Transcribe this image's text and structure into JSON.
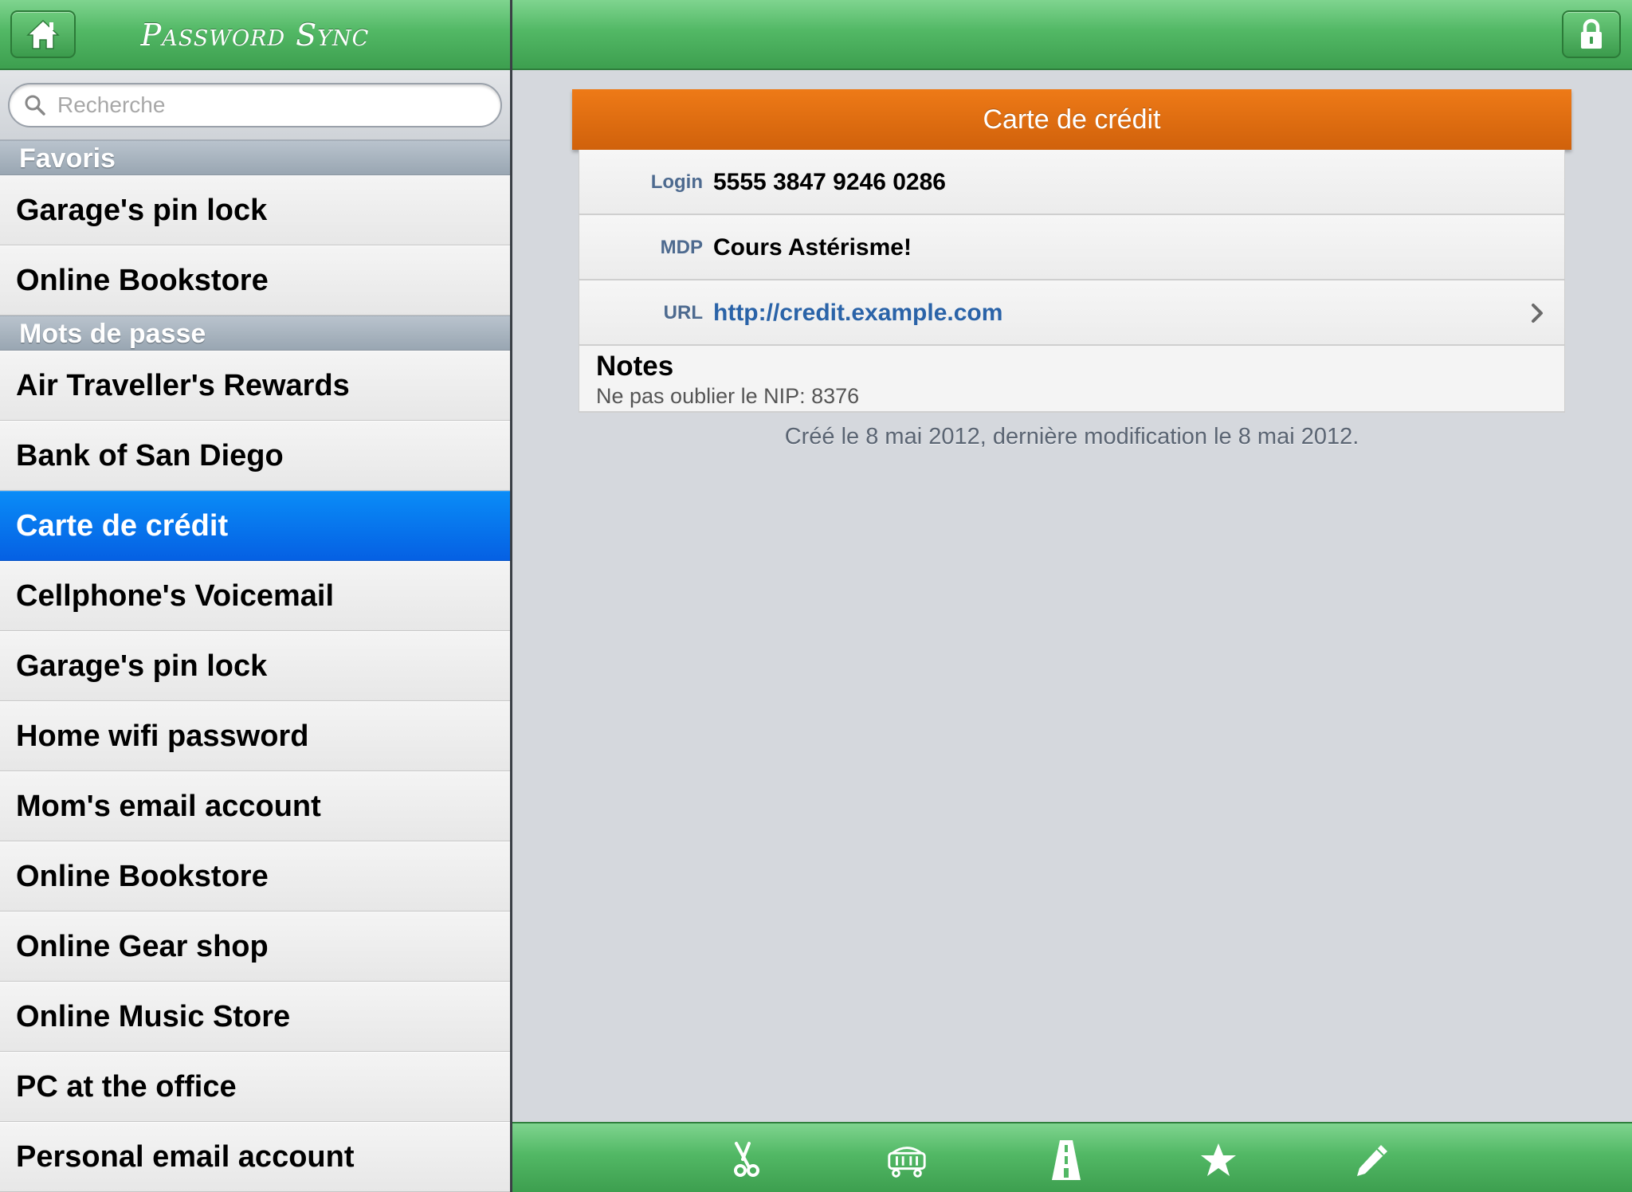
{
  "app": {
    "title": "Password Sync"
  },
  "search": {
    "placeholder": "Recherche",
    "value": ""
  },
  "sections": [
    {
      "header": "Favoris",
      "items": [
        "Garage's pin lock",
        "Online Bookstore"
      ]
    },
    {
      "header": "Mots de passe",
      "items": [
        "Air Traveller's Rewards",
        "Bank of San Diego",
        "Carte de crédit",
        "Cellphone's Voicemail",
        "Garage's pin lock",
        "Home wifi password",
        "Mom's email account",
        "Online Bookstore",
        "Online Gear shop",
        "Online Music Store",
        "PC at the office",
        "Personal email account"
      ]
    }
  ],
  "selected_item": "Carte de crédit",
  "detail": {
    "title": "Carte de crédit",
    "fields": [
      {
        "label": "Login",
        "value": "5555 3847 9246 0286",
        "is_link": false
      },
      {
        "label": "MDP",
        "value": "Cours Astérisme!",
        "is_link": false
      },
      {
        "label": "URL",
        "value": "http://credit.example.com",
        "is_link": true
      }
    ],
    "notes_title": "Notes",
    "notes": "Ne pas oublier le NIP: 8376",
    "footnote": "Créé le 8 mai 2012, dernière modification le 8 mai 2012."
  },
  "toolbar": {
    "icons": [
      "scissors-icon",
      "sync-icon",
      "road-icon",
      "star-icon",
      "pencil-icon"
    ]
  },
  "colors": {
    "nav_green": "#52b865",
    "selection_blue": "#0a7cf0",
    "header_orange": "#e06d10",
    "link_blue": "#2a63a8",
    "label_blue": "#4d6a8f"
  }
}
